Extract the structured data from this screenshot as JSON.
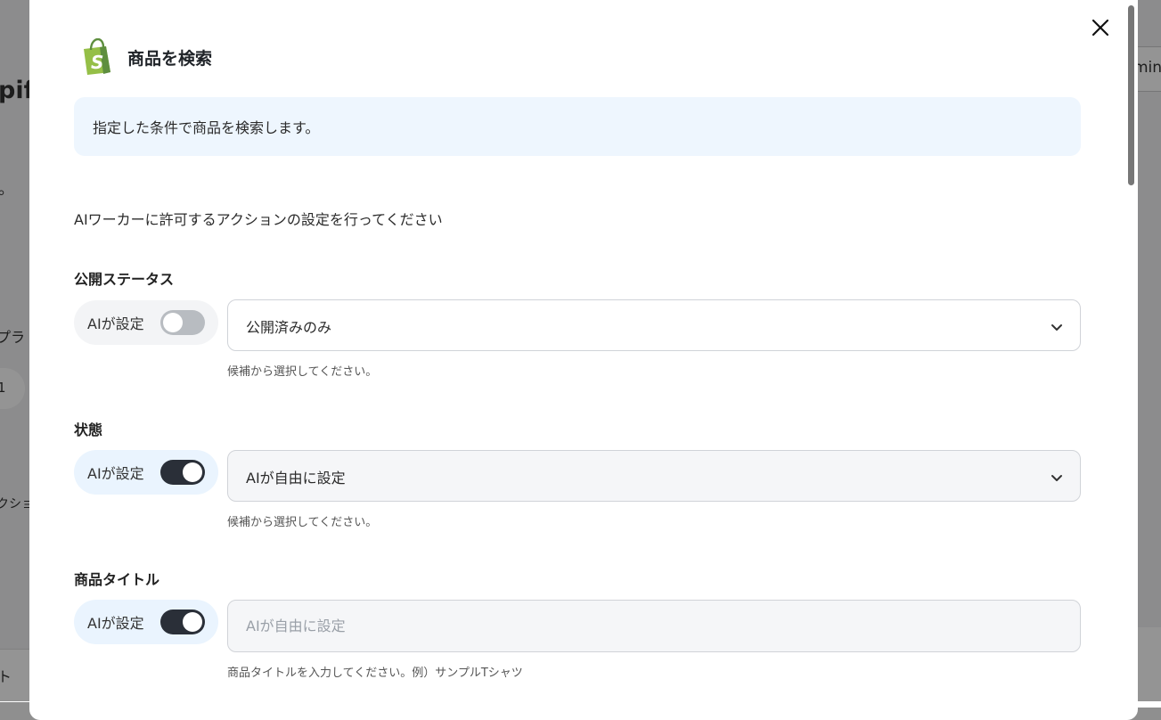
{
  "background": {
    "title_fragment": "pif",
    "dot_fragment": "。",
    "tab_fragment": "プラ",
    "pill_fragment": "1",
    "action_fragment": "クショ",
    "bottom_fragment": "ト",
    "right_tab_fragment": "min"
  },
  "modal": {
    "title": "商品を検索",
    "icon": "shopify-bag-icon",
    "description": "指定した条件で商品を検索します。",
    "intro": "AIワーカーに許可するアクションの設定を行ってください",
    "fields": [
      {
        "label": "公開ステータス",
        "ai_label": "AIが設定",
        "ai_enabled": false,
        "value": "公開済みのみ",
        "hint": "候補から選択してください。"
      },
      {
        "label": "状態",
        "ai_label": "AIが設定",
        "ai_enabled": true,
        "value": "AIが自由に設定",
        "hint": "候補から選択してください。"
      },
      {
        "label": "商品タイトル",
        "ai_label": "AIが設定",
        "ai_enabled": true,
        "placeholder": "AIが自由に設定",
        "hint": "商品タイトルを入力してください。例）サンプルTシャツ"
      }
    ]
  },
  "colors": {
    "brand_green": "#95bf47",
    "toggle_on": "#2a2f38",
    "toggle_off": "#b8bcc1",
    "description_bg": "#eef6fe"
  }
}
